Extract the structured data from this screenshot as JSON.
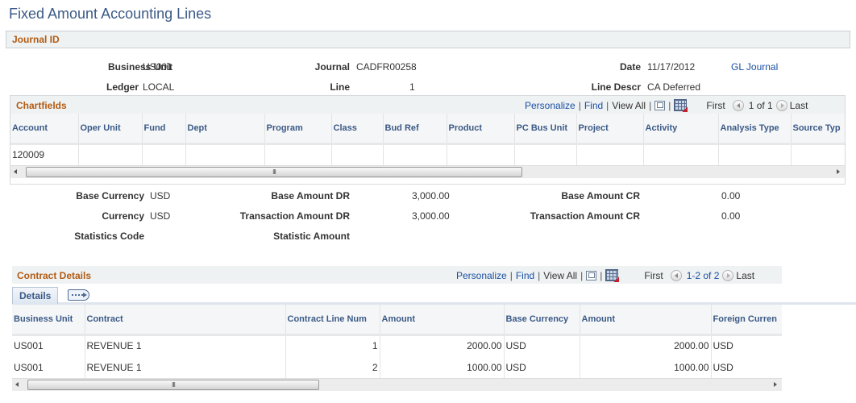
{
  "page": {
    "title": "Fixed Amount Accounting Lines"
  },
  "journal_section": {
    "title": "Journal ID",
    "fields": {
      "business_unit": {
        "label": "Business Unit",
        "value": "US001"
      },
      "journal": {
        "label": "Journal",
        "value": "CADFR00258"
      },
      "date": {
        "label": "Date",
        "value": "11/17/2012"
      },
      "gl_journal_link": "GL Journal",
      "ledger": {
        "label": "Ledger",
        "value": "LOCAL"
      },
      "line": {
        "label": "Line",
        "value": "1"
      },
      "line_descr": {
        "label": "Line Descr",
        "value": "CA Deferred"
      }
    }
  },
  "chartfields": {
    "title": "Chartfields",
    "toolbar": {
      "personalize": "Personalize",
      "find": "Find",
      "view_all": "View All",
      "first": "First",
      "range": "1 of 1",
      "last": "Last"
    },
    "columns": [
      "Account",
      "Oper Unit",
      "Fund",
      "Dept",
      "Program",
      "Class",
      "Bud Ref",
      "Product",
      "PC Bus Unit",
      "Project",
      "Activity",
      "Analysis Type",
      "Source Typ"
    ],
    "rows": [
      [
        "120009",
        "",
        "",
        "",
        "",
        "",
        "",
        "",
        "",
        "",
        "",
        "",
        ""
      ]
    ]
  },
  "amounts": {
    "base_currency": {
      "label": "Base Currency",
      "value": "USD"
    },
    "base_amount_dr": {
      "label": "Base Amount DR",
      "value": "3,000.00"
    },
    "base_amount_cr": {
      "label": "Base Amount CR",
      "value": "0.00"
    },
    "currency": {
      "label": "Currency",
      "value": "USD"
    },
    "transaction_amount_dr": {
      "label": "Transaction Amount DR",
      "value": "3,000.00"
    },
    "transaction_amount_cr": {
      "label": "Transaction Amount CR",
      "value": "0.00"
    },
    "statistics_code": {
      "label": "Statistics Code",
      "value": ""
    },
    "statistic_amount": {
      "label": "Statistic Amount",
      "value": ""
    }
  },
  "contract_details": {
    "title": "Contract Details",
    "toolbar": {
      "personalize": "Personalize",
      "find": "Find",
      "view_all": "View All",
      "first": "First",
      "range": "1-2 of 2",
      "last": "Last"
    },
    "tabs": [
      {
        "label": "Details",
        "active": true
      }
    ],
    "columns": [
      "Business Unit",
      "Contract",
      "Contract Line Num",
      "Amount",
      "Base Currency",
      "Amount",
      "Foreign Curren"
    ],
    "rows": [
      [
        "US001",
        "REVENUE 1",
        "1",
        "2000.00",
        "USD",
        "2000.00",
        "USD"
      ],
      [
        "US001",
        "REVENUE 1",
        "2",
        "1000.00",
        "USD",
        "1000.00",
        "USD"
      ]
    ]
  }
}
